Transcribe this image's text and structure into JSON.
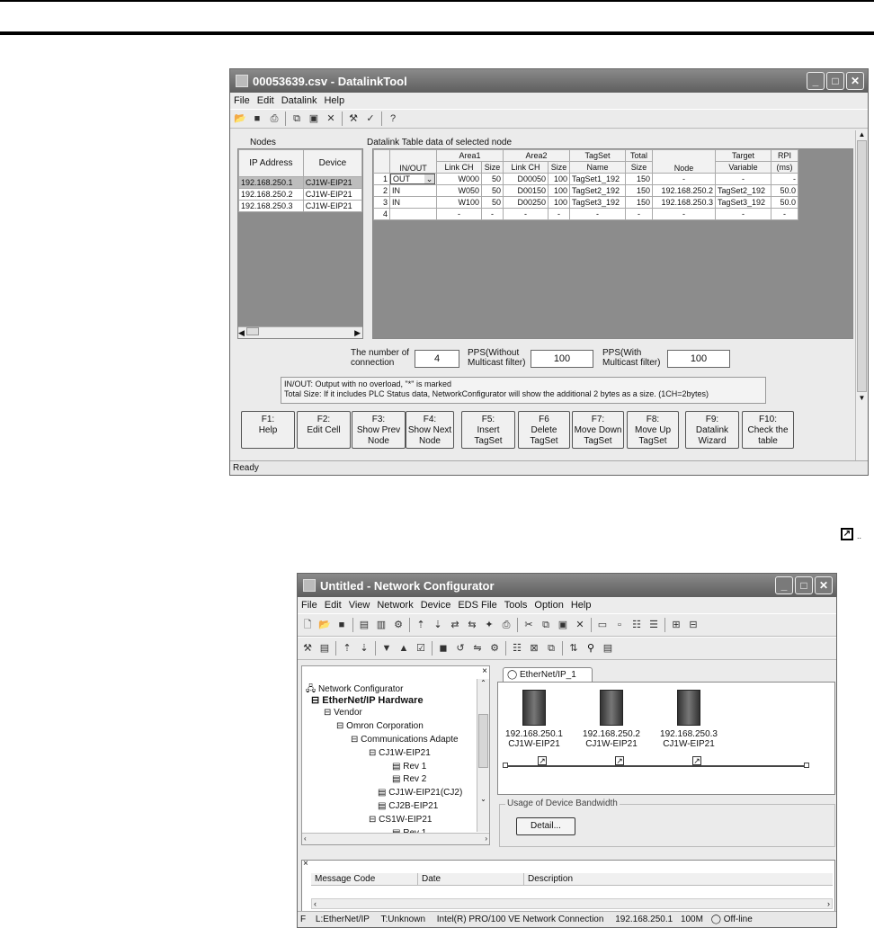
{
  "top_icon": "shortcut-link-icon",
  "datalink": {
    "title": "00053639.csv - DatalinkTool",
    "menu": [
      "File",
      "Edit",
      "Datalink",
      "Help"
    ],
    "nodes_label": "Nodes",
    "table_label": "Datalink Table data of selected node",
    "node_headers": [
      "IP Address",
      "Device"
    ],
    "nodes": [
      {
        "ip": "192.168.250.1",
        "device": "CJ1W-EIP21"
      },
      {
        "ip": "192.168.250.2",
        "device": "CJ1W-EIP21"
      },
      {
        "ip": "192.168.250.3",
        "device": "CJ1W-EIP21"
      }
    ],
    "headers": {
      "inout": "IN/OUT",
      "area1": "Area1",
      "area2": "Area2",
      "linkch": "Link CH",
      "size": "Size",
      "tagset": "TagSet",
      "tagset2": "Name",
      "total": "Total",
      "total2": "Size",
      "node": "Node",
      "target": "Target",
      "target2": "Variable",
      "rpi": "RPI",
      "rpi2": "(ms)"
    },
    "rows": [
      {
        "n": "1",
        "io": "OUT",
        "a1": "W000",
        "s1": "50",
        "a2": "D00050",
        "s2": "100",
        "tag": "TagSet1_192",
        "total": "150",
        "node": "-",
        "target": "-",
        "rpi": "-"
      },
      {
        "n": "2",
        "io": "IN",
        "a1": "W050",
        "s1": "50",
        "a2": "D00150",
        "s2": "100",
        "tag": "TagSet2_192",
        "total": "150",
        "node": "192.168.250.2",
        "target": "TagSet2_192",
        "rpi": "50.0"
      },
      {
        "n": "3",
        "io": "IN",
        "a1": "W100",
        "s1": "50",
        "a2": "D00250",
        "s2": "100",
        "tag": "TagSet3_192",
        "total": "150",
        "node": "192.168.250.3",
        "target": "TagSet3_192",
        "rpi": "50.0"
      },
      {
        "n": "4",
        "io": "",
        "a1": "-",
        "s1": "-",
        "a2": "-",
        "s2": "-",
        "tag": "-",
        "total": "-",
        "node": "-",
        "target": "-",
        "rpi": "-"
      }
    ],
    "conn_label1": "The number of",
    "conn_label2": "connection",
    "conn_value": "4",
    "pps1_label1": "PPS(Without",
    "pps1_label2": "Multicast filter)",
    "pps1_value": "100",
    "pps2_label1": "PPS(With",
    "pps2_label2": "Multicast filter)",
    "pps2_value": "100",
    "note1": "IN/OUT: Output with no overload, \"*\" is marked",
    "note2": "Total Size: If it includes PLC Status data, NetworkConfigurator will show the additional 2 bytes as a size. (1CH=2bytes)",
    "fkeys": [
      [
        "F1:",
        "Help",
        ""
      ],
      [
        "F2:",
        "Edit Cell",
        ""
      ],
      [
        "F3:",
        "Show Prev",
        "Node"
      ],
      [
        "F4:",
        "Show Next",
        "Node"
      ],
      [
        "F5:",
        "Insert",
        "TagSet"
      ],
      [
        "F6",
        "Delete",
        "TagSet"
      ],
      [
        "F7:",
        "Move Down",
        "TagSet"
      ],
      [
        "F8:",
        "Move Up",
        "TagSet"
      ],
      [
        "F9:",
        "Datalink",
        "Wizard"
      ],
      [
        "F10:",
        "Check the",
        "table"
      ]
    ],
    "status": "Ready"
  },
  "netconf": {
    "title": "Untitled - Network Configurator",
    "menu": [
      "File",
      "Edit",
      "View",
      "Network",
      "Device",
      "EDS File",
      "Tools",
      "Option",
      "Help"
    ],
    "tree": [
      "Network Configurator",
      "EtherNet/IP Hardware",
      "Vendor",
      "Omron Corporation",
      "Communications Adapte",
      "CJ1W-EIP21",
      "Rev 1",
      "Rev 2",
      "CJ1W-EIP21(CJ2)",
      "CJ2B-EIP21",
      "CS1W-EIP21",
      "Rev 1"
    ],
    "tab": "EtherNet/IP_1",
    "devices": [
      {
        "ip": "192.168.250.1",
        "model": "CJ1W-EIP21"
      },
      {
        "ip": "192.168.250.2",
        "model": "CJ1W-EIP21"
      },
      {
        "ip": "192.168.250.3",
        "model": "CJ1W-EIP21"
      }
    ],
    "bandwidth_label": "Usage of Device Bandwidth",
    "detail_button": "Detail...",
    "msg_headers": [
      "Message Code",
      "Date",
      "Description"
    ],
    "status": [
      "L:EtherNet/IP",
      "T:Unknown",
      "Intel(R) PRO/100 VE Network Connection",
      "192.168.250.1",
      "100M",
      "Off-line"
    ]
  }
}
